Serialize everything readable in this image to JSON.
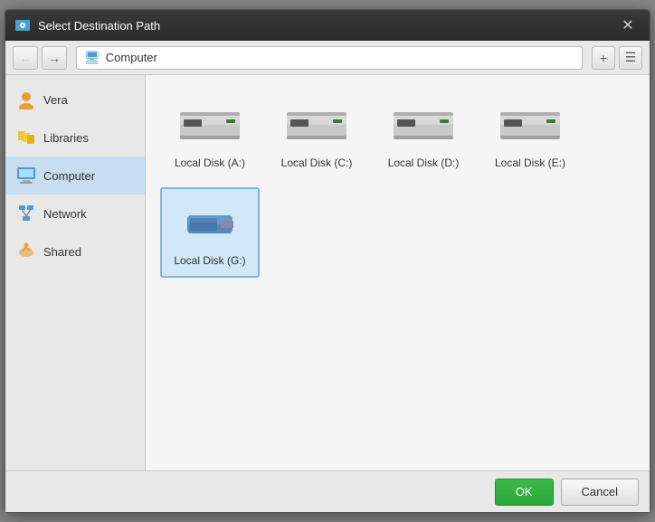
{
  "dialog": {
    "title": "Select Destination Path",
    "close_label": "✕"
  },
  "toolbar": {
    "back_label": "←",
    "forward_label": "→",
    "address": "Computer",
    "new_folder_label": "+",
    "view_label": "☰"
  },
  "sidebar": {
    "items": [
      {
        "id": "vera",
        "label": "Vera",
        "icon": "user-icon"
      },
      {
        "id": "libraries",
        "label": "Libraries",
        "icon": "libraries-icon"
      },
      {
        "id": "computer",
        "label": "Computer",
        "icon": "computer-icon",
        "active": true
      },
      {
        "id": "network",
        "label": "Network",
        "icon": "network-icon"
      },
      {
        "id": "shared",
        "label": "Shared",
        "icon": "shared-icon"
      }
    ]
  },
  "disks": [
    {
      "id": "a",
      "label": "Local Disk (A:)",
      "type": "hdd",
      "selected": false
    },
    {
      "id": "c",
      "label": "Local Disk (C:)",
      "type": "hdd",
      "selected": false
    },
    {
      "id": "d",
      "label": "Local Disk (D:)",
      "type": "hdd",
      "selected": false
    },
    {
      "id": "e",
      "label": "Local Disk (E:)",
      "type": "hdd",
      "selected": false
    },
    {
      "id": "g",
      "label": "Local Disk (G:)",
      "type": "usb",
      "selected": true
    }
  ],
  "footer": {
    "ok_label": "OK",
    "cancel_label": "Cancel"
  },
  "colors": {
    "ok_bg": "#2da83a",
    "accent": "#4a9fd4"
  }
}
